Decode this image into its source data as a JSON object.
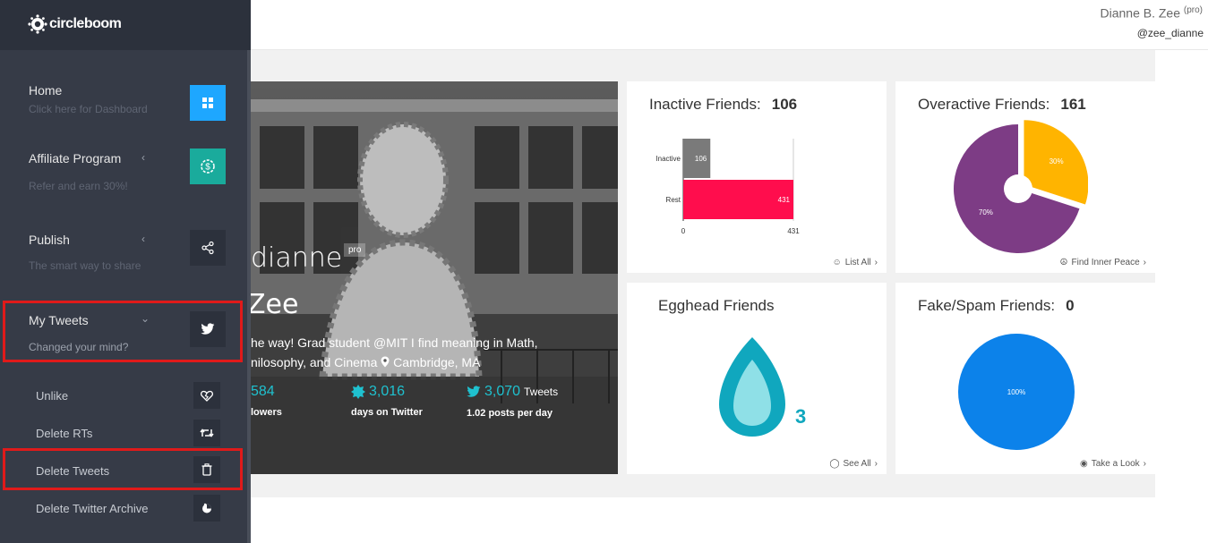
{
  "user": {
    "name": "Dianne B. Zee",
    "badge": "(pro)",
    "handle": "@zee_dianne"
  },
  "brand": {
    "logo_text": "circleboom"
  },
  "sidebar": {
    "items": [
      {
        "title": "Home",
        "subtitle": "Click here for Dashboard",
        "icon": "grid-icon",
        "color": "#1ea7ff"
      },
      {
        "title": "Affiliate Program",
        "subtitle": "Refer and earn 30%!",
        "icon": "dollar-gear-icon",
        "color": "#1aab9c"
      },
      {
        "title": "Publish",
        "subtitle": "The smart way to share",
        "icon": "share-icon",
        "color": "#2c313c"
      },
      {
        "title": "My Tweets",
        "subtitle": "Changed your mind?",
        "icon": "twitter-bird-icon",
        "color": "#2c313c"
      }
    ],
    "subitems": [
      {
        "label": "Unlike",
        "icon": "broken-heart-icon"
      },
      {
        "label": "Delete RTs",
        "icon": "retweet-icon"
      },
      {
        "label": "Delete Tweets",
        "icon": "trash-icon"
      },
      {
        "label": "Delete Twitter Archive",
        "icon": "archive-icon"
      }
    ]
  },
  "profile": {
    "name_first": "dianne",
    "name_last": "Zee",
    "badge": "pro",
    "bio_line1": "he way! Grad student @MIT I find meaning in Math,",
    "bio_line2": "nilosophy, and Cinema",
    "location": "Cambridge, MA",
    "stats": [
      {
        "value": "584",
        "label": "lowers"
      },
      {
        "value": "3,016",
        "label": "days on Twitter"
      },
      {
        "value": "3,070",
        "label": "1.02 posts per day",
        "suffix": "Tweets"
      }
    ]
  },
  "cards": {
    "inactive": {
      "title": "Inactive Friends:",
      "count": "106",
      "link": "List All"
    },
    "overactive": {
      "title": "Overactive Friends:",
      "count": "161",
      "link": "Find Inner Peace"
    },
    "egghead": {
      "title": "Egghead Friends",
      "count": "3",
      "link": "See All"
    },
    "fake": {
      "title": "Fake/Spam Friends:",
      "count": "0",
      "link": "Take a Look"
    }
  },
  "chart_data": [
    {
      "type": "bar",
      "categories": [
        "Inactive",
        "Rest"
      ],
      "values": [
        106,
        431
      ],
      "colors": [
        "#7a7a7a",
        "#ff0d4d"
      ],
      "xlim": [
        0,
        431
      ],
      "xticks": [
        "0",
        "431"
      ]
    },
    {
      "type": "pie",
      "labels": [
        "30%",
        "70%"
      ],
      "values": [
        30,
        70
      ],
      "colors": [
        "#ffb400",
        "#7d3c85"
      ]
    },
    {
      "type": "pie",
      "labels": [
        "100%"
      ],
      "values": [
        100
      ],
      "colors": [
        "#0c82ea"
      ]
    }
  ]
}
